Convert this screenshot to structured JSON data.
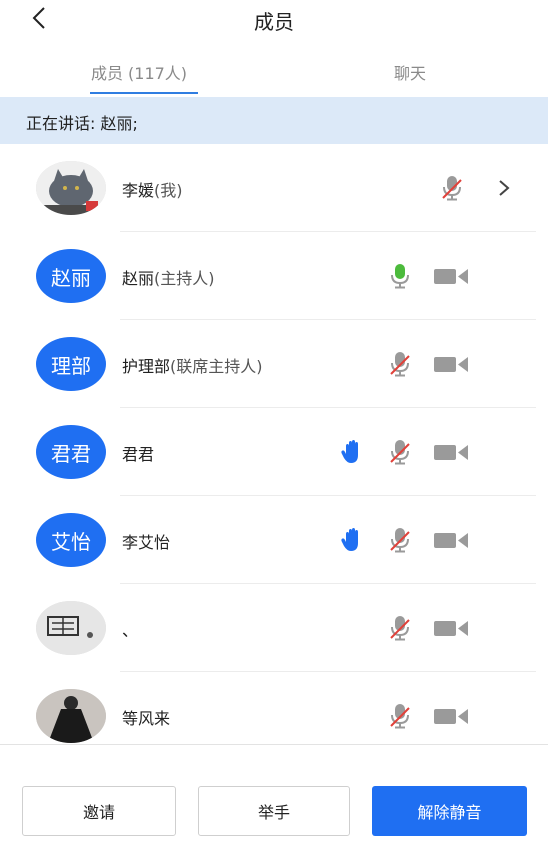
{
  "header": {
    "title": "成员"
  },
  "tabs": [
    {
      "label": "成员 (117人)",
      "active": true
    },
    {
      "label": "聊天",
      "active": false
    }
  ],
  "speaking": {
    "text": "正在讲话: 赵丽;"
  },
  "members": [
    {
      "avatar_type": "photo",
      "avatar_desc": "cat",
      "name": "李媛",
      "role": "(我)",
      "mic": "muted",
      "camera": null,
      "hand": false,
      "chevron": true
    },
    {
      "avatar_type": "text",
      "avatar_text": "赵丽",
      "name": "赵丽",
      "role": "(主持人)",
      "mic": "active",
      "camera": "on",
      "hand": false,
      "chevron": false
    },
    {
      "avatar_type": "text",
      "avatar_text": "理部",
      "name": "护理部",
      "role": "(联席主持人)",
      "mic": "muted",
      "camera": "on",
      "hand": false,
      "chevron": false
    },
    {
      "avatar_type": "text",
      "avatar_text": "君君",
      "name": "君君",
      "role": "",
      "mic": "muted",
      "camera": "on",
      "hand": true,
      "chevron": false
    },
    {
      "avatar_type": "text",
      "avatar_text": "艾怡",
      "name": "李艾怡",
      "role": "",
      "mic": "muted",
      "camera": "on",
      "hand": true,
      "chevron": false
    },
    {
      "avatar_type": "photo",
      "avatar_desc": "calligraphy",
      "name": "、",
      "role": "",
      "mic": "muted",
      "camera": "on",
      "hand": false,
      "chevron": false
    },
    {
      "avatar_type": "photo",
      "avatar_desc": "dress",
      "name": "等风来",
      "role": "",
      "mic": "muted",
      "camera": "on",
      "hand": false,
      "chevron": false
    }
  ],
  "buttons": {
    "invite": "邀请",
    "raise_hand": "举手",
    "unmute": "解除静音"
  },
  "colors": {
    "accent": "#1f6ff2",
    "mic_active": "#4cbb3c",
    "mic_muted_slash": "#e0413a",
    "icon_grey": "#9a9a9a"
  },
  "icons": {
    "back": "chevron-left-icon",
    "mic": "microphone-icon",
    "camera": "video-camera-icon",
    "hand": "raise-hand-icon",
    "chevron": "chevron-right-icon"
  }
}
